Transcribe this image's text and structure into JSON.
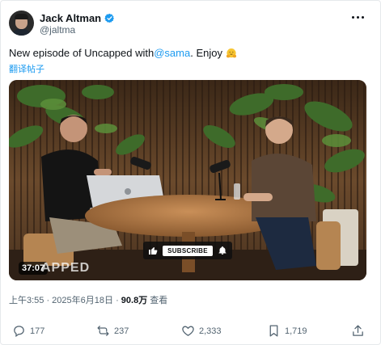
{
  "author": {
    "display_name": "Jack Altman",
    "handle": "@jaltma"
  },
  "tweet": {
    "text_before": "New episode of Uncapped with ",
    "mention": "@sama",
    "text_after": ". Enjoy",
    "emoji": "hugging-face",
    "translate_label": "翻译帖子"
  },
  "video": {
    "duration": "37:07",
    "watermark": "APPED",
    "subscribe_label": "SUBSCRIBE"
  },
  "meta": {
    "time_date": "上午3:55 · 2025年6月18日 · ",
    "views": "90.8万",
    "views_label": " 查看"
  },
  "actions": {
    "replies": "177",
    "reposts": "237",
    "likes": "2,333",
    "bookmarks": "1,719"
  },
  "colors": {
    "accent": "#1d9bf0",
    "text": "#0f1419",
    "muted": "#536471"
  }
}
